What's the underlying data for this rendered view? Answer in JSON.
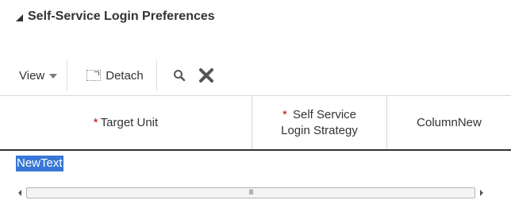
{
  "section": {
    "title": "Self-Service Login Preferences"
  },
  "toolbar": {
    "view_label": "View",
    "detach_label": "Detach",
    "search_icon": "search-icon",
    "clear_icon": "close-icon"
  },
  "table": {
    "columns": [
      {
        "label": "Target Unit",
        "required": true,
        "required_mark": "*"
      },
      {
        "label_line1": "Self Service",
        "label_line2": "Login Strategy",
        "required": true,
        "required_mark": "*"
      },
      {
        "label": "ColumnNew"
      }
    ],
    "rows": [
      {
        "target_unit": "NewText"
      }
    ]
  },
  "scrollbar": {
    "grip": "III"
  },
  "colors": {
    "selection": "#3877d6",
    "required": "#d00000",
    "text": "#333333"
  }
}
